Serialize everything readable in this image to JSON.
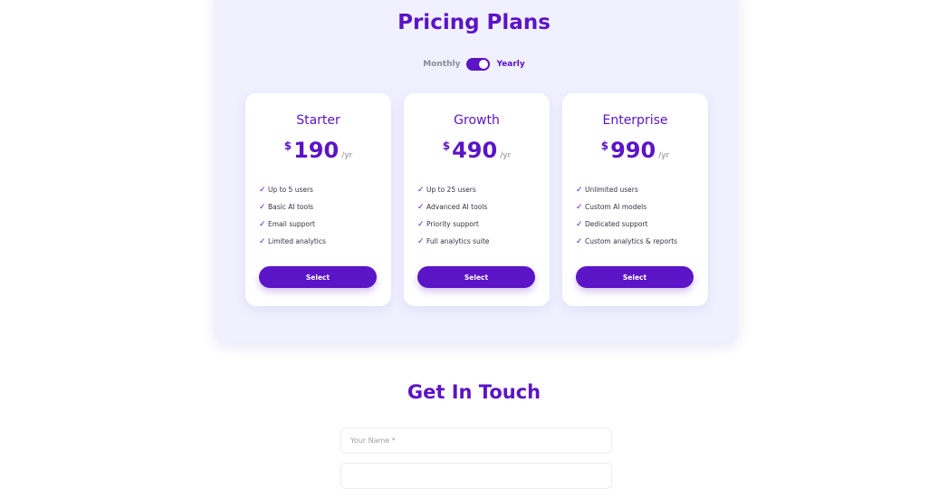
{
  "pricing": {
    "title": "Pricing Plans",
    "toggle": {
      "monthly_label": "Monthly",
      "yearly_label": "Yearly",
      "selected": "Yearly"
    },
    "plans": [
      {
        "name": "Starter",
        "currency": "$",
        "price": "190",
        "period": "/yr",
        "features": [
          "Up to 5 users",
          "Basic AI tools",
          "Email support",
          "Limited analytics"
        ],
        "button_label": "Select"
      },
      {
        "name": "Growth",
        "currency": "$",
        "price": "490",
        "period": "/yr",
        "features": [
          "Up to 25 users",
          "Advanced AI tools",
          "Priority support",
          "Full analytics suite"
        ],
        "button_label": "Select"
      },
      {
        "name": "Enterprise",
        "currency": "$",
        "price": "990",
        "period": "/yr",
        "features": [
          "Unlimited users",
          "Custom AI models",
          "Dedicated support",
          "Custom analytics & reports"
        ],
        "button_label": "Select"
      }
    ]
  },
  "contact": {
    "title": "Get In Touch",
    "name_field": {
      "value": "",
      "placeholder": "Your Name *"
    },
    "second_field": {
      "value": "",
      "placeholder": ""
    }
  },
  "icons": {
    "check": "check-icon"
  },
  "colors": {
    "accent": "#5b14c6",
    "panel_background": "#f0f0ff",
    "muted_text": "#8a8a96"
  }
}
